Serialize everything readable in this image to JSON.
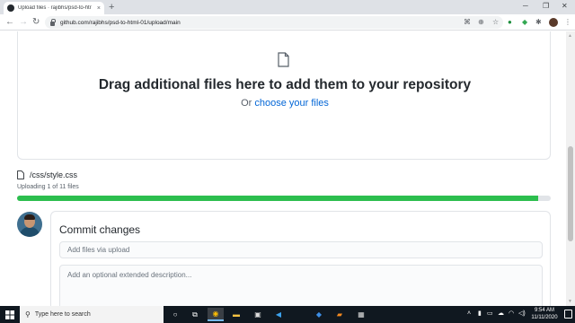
{
  "browser": {
    "tab_title": "Upload files · rajibhs/psd-to-htr",
    "tab_close": "×",
    "new_tab": "+",
    "window_minimize": "─",
    "window_restore": "❐",
    "window_close": "✕",
    "back": "←",
    "forward": "→",
    "reload": "↻",
    "url": "github.com/rajibhs/psd-to-html-01/upload/main",
    "icons": [
      "translate-icon",
      "zoom-icon",
      "bookmark-star-icon",
      "extension-icon",
      "extension-icon",
      "puzzle-icon",
      "profile-avatar",
      "menu-icon"
    ]
  },
  "dropzone": {
    "title": "Drag additional files here to add them to your repository",
    "or_text": "Or ",
    "choose_link": "choose your files"
  },
  "upload": {
    "file_name": "/css/style.css",
    "status": "Uploading 1 of 11 files",
    "progress": 0.976,
    "progress_color": "#2cbe4e"
  },
  "commit": {
    "title": "Commit changes",
    "summary_placeholder": "Add files via upload",
    "description_placeholder": "Add an optional extended description..."
  },
  "taskbar": {
    "search_placeholder": "Type here to search",
    "time": "9:54 AM",
    "date": "11/11/2020",
    "apps": [
      "cortana-icon",
      "task-view-icon",
      "chrome-icon",
      "file-explorer-icon",
      "store-icon",
      "vscode-icon",
      "dropbox-icon",
      "sublime-icon",
      "app-icon"
    ]
  },
  "colors": {
    "accent_link": "#0366d6",
    "progress": "#2cbe4e",
    "taskbar": "#101820"
  }
}
